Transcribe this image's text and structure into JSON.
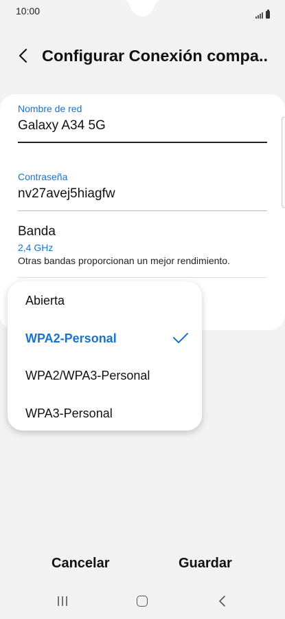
{
  "status_bar": {
    "time": "10:00"
  },
  "header": {
    "title": "Configurar Conexión compa..."
  },
  "form": {
    "network_name_label": "Nombre de red",
    "network_name_value": "Galaxy A34 5G",
    "password_label": "Contraseña",
    "password_value": "nv27avej5hiagfw",
    "band_title": "Banda",
    "band_value": "2,4 GHz",
    "band_description": "Otras bandas proporcionan un mejor rendimiento."
  },
  "security_dropdown": {
    "options": [
      "Abierta",
      "WPA2-Personal",
      "WPA2/WPA3-Personal",
      "WPA3-Personal"
    ],
    "selected": "WPA2-Personal"
  },
  "actions": {
    "cancel_label": "Cancelar",
    "save_label": "Guardar"
  },
  "colors": {
    "accent": "#1a73c9",
    "background": "#f2f2f2",
    "card": "#ffffff"
  },
  "icons": [
    "signal-icon",
    "battery-icon",
    "back-arrow-icon",
    "check-icon",
    "recent-apps-icon",
    "home-icon",
    "nav-back-icon"
  ]
}
